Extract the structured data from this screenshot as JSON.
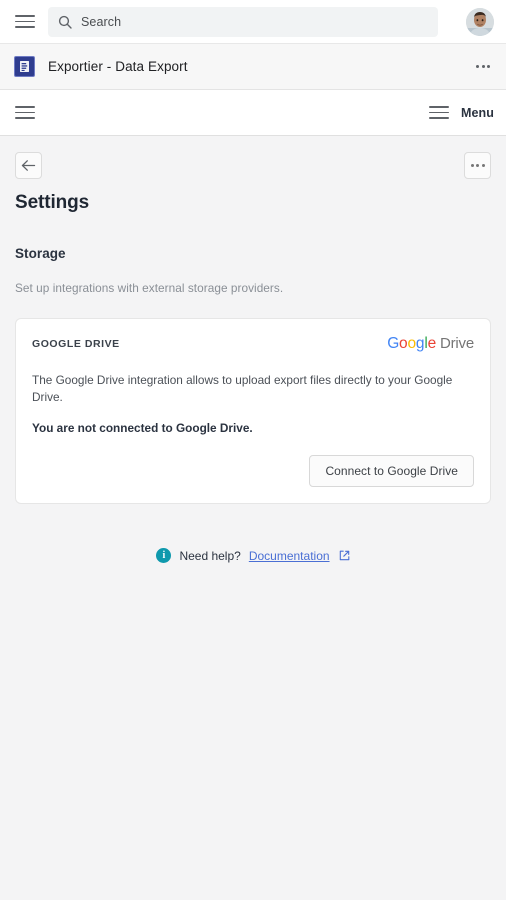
{
  "topbar": {
    "menu_icon": "hamburger-icon",
    "search": {
      "icon": "search-icon",
      "placeholder": "Search",
      "value": ""
    },
    "avatar": "user-avatar"
  },
  "app_row": {
    "icon": "exporter-app-icon",
    "title": "Exportier - Data Export",
    "overflow": "more-options-icon"
  },
  "menu_row": {
    "left_icon": "hamburger-icon",
    "right_icon": "hamburger-icon",
    "menu_label": "Menu"
  },
  "toolbar": {
    "back_icon": "arrow-left-icon",
    "overflow_icon": "more-options-icon"
  },
  "page": {
    "title": "Settings"
  },
  "storage": {
    "section_title": "Storage",
    "section_desc": "Set up integrations with external storage providers."
  },
  "gdrive_card": {
    "eyebrow": "GOOGLE DRIVE",
    "logo": {
      "letters": [
        {
          "char": "G",
          "color": "#4285F4"
        },
        {
          "char": "o",
          "color": "#EA4335"
        },
        {
          "char": "o",
          "color": "#FBBC05"
        },
        {
          "char": "g",
          "color": "#4285F4"
        },
        {
          "char": "l",
          "color": "#34A853"
        },
        {
          "char": "e",
          "color": "#EA4335"
        }
      ],
      "suffix": "Drive"
    },
    "description": "The Google Drive integration allows to upload export files directly to your Google Drive.",
    "status": "You are not connected to Google Drive.",
    "connect_label": "Connect to Google Drive"
  },
  "help": {
    "icon": "info-icon",
    "text": "Need help?",
    "link_label": "Documentation",
    "external_icon": "external-link-icon"
  },
  "colors": {
    "page_bg": "#f4f4f5",
    "card_bg": "#ffffff",
    "app_icon_bg": "#2f3d8f",
    "info_teal": "#0f99ad",
    "link_blue": "#4a6fd4"
  }
}
